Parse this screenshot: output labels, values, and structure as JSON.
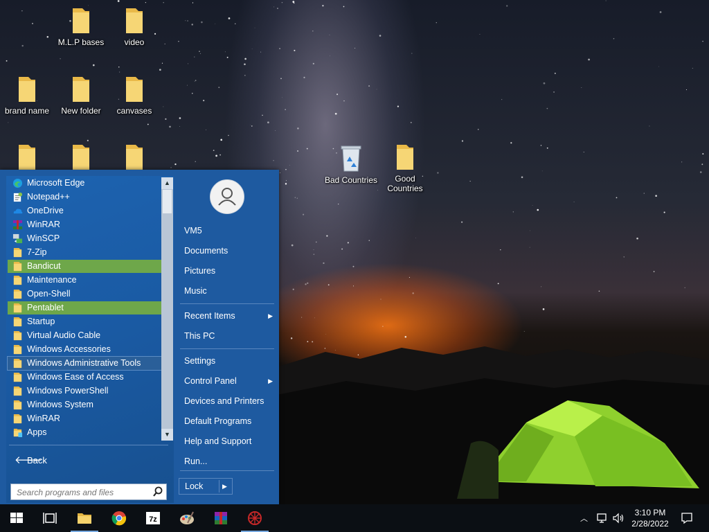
{
  "desktop_icons": [
    {
      "label": "M.L.P bases",
      "type": "folder"
    },
    {
      "label": "video",
      "type": "folder"
    },
    {
      "label": "brand name",
      "type": "folder"
    },
    {
      "label": "New folder",
      "type": "folder"
    },
    {
      "label": "canvases",
      "type": "folder"
    },
    {
      "label": "",
      "type": "folder"
    },
    {
      "label": "",
      "type": "folder"
    },
    {
      "label": "",
      "type": "folder"
    },
    {
      "label": "Bad Countries",
      "type": "recycle-bin"
    },
    {
      "label": "Good Countries",
      "type": "folder"
    }
  ],
  "start_menu": {
    "programs": [
      {
        "label": "Microsoft Edge",
        "icon": "edge-icon",
        "state": "normal"
      },
      {
        "label": "Notepad++",
        "icon": "notepadpp-icon",
        "state": "normal"
      },
      {
        "label": "OneDrive",
        "icon": "onedrive-icon",
        "state": "normal"
      },
      {
        "label": "WinRAR",
        "icon": "winrar-icon",
        "state": "normal"
      },
      {
        "label": "WinSCP",
        "icon": "winscp-icon",
        "state": "normal"
      },
      {
        "label": "7-Zip",
        "icon": "folder-icon",
        "state": "normal"
      },
      {
        "label": "Bandicut",
        "icon": "folder-icon",
        "state": "highlighted"
      },
      {
        "label": "Maintenance",
        "icon": "folder-icon",
        "state": "normal"
      },
      {
        "label": "Open-Shell",
        "icon": "folder-icon",
        "state": "normal"
      },
      {
        "label": "Pentablet",
        "icon": "folder-icon",
        "state": "highlighted"
      },
      {
        "label": "Startup",
        "icon": "folder-icon",
        "state": "normal"
      },
      {
        "label": "Virtual Audio Cable",
        "icon": "folder-icon",
        "state": "normal"
      },
      {
        "label": "Windows Accessories",
        "icon": "folder-icon",
        "state": "normal"
      },
      {
        "label": "Windows Administrative Tools",
        "icon": "folder-icon",
        "state": "selected"
      },
      {
        "label": "Windows Ease of Access",
        "icon": "folder-icon",
        "state": "normal"
      },
      {
        "label": "Windows PowerShell",
        "icon": "folder-icon",
        "state": "normal"
      },
      {
        "label": "Windows System",
        "icon": "folder-icon",
        "state": "normal"
      },
      {
        "label": "WinRAR",
        "icon": "folder-icon",
        "state": "normal"
      },
      {
        "label": "Apps",
        "icon": "apps-icon",
        "state": "normal"
      }
    ],
    "back_label": "Back",
    "search_placeholder": "Search programs and files",
    "right_items": [
      {
        "label": "VM5",
        "submenu": false
      },
      {
        "label": "Documents",
        "submenu": false
      },
      {
        "label": "Pictures",
        "submenu": false
      },
      {
        "label": "Music",
        "submenu": false
      },
      {
        "label": "Recent Items",
        "submenu": true
      },
      {
        "label": "This PC",
        "submenu": false
      },
      {
        "label": "Settings",
        "submenu": false
      },
      {
        "label": "Control Panel",
        "submenu": true
      },
      {
        "label": "Devices and Printers",
        "submenu": false
      },
      {
        "label": "Default Programs",
        "submenu": false
      },
      {
        "label": "Help and Support",
        "submenu": false
      },
      {
        "label": "Run...",
        "submenu": false
      }
    ],
    "lock_label": "Lock"
  },
  "taskbar": {
    "apps": [
      "start-icon",
      "task-view-icon",
      "file-explorer-icon",
      "chrome-icon",
      "7zip-icon",
      "paint-icon",
      "winrar-icon",
      "app-icon"
    ],
    "clock_time": "3:10 PM",
    "clock_date": "2/28/2022"
  },
  "colors": {
    "start_menu_bg": "#1e5aa0",
    "highlight": "#6ea74a",
    "folder": "#f3cf62",
    "taskbar": "#0b0f14"
  }
}
